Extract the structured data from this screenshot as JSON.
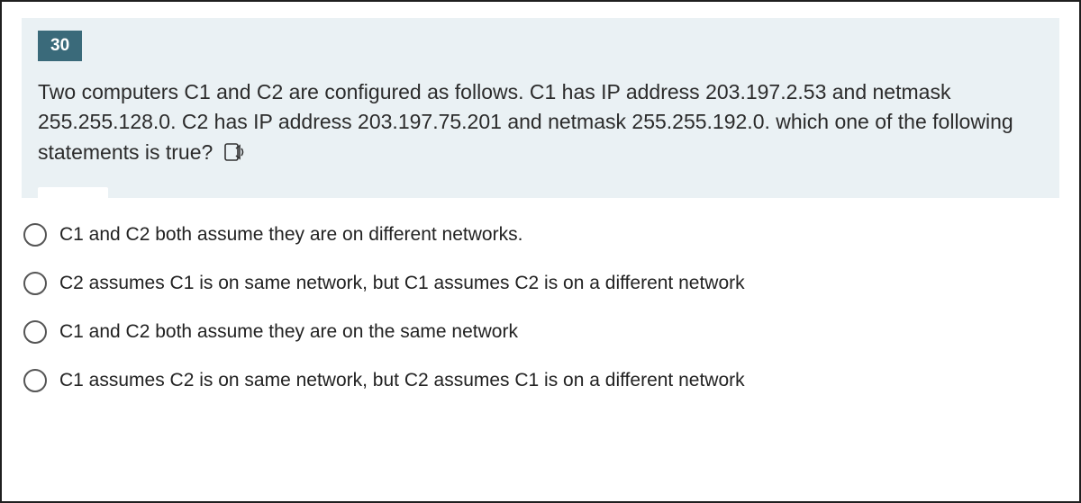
{
  "question": {
    "number": "30",
    "text": "Two computers C1 and C2 are configured as follows. C1 has IP address 203.197.2.53 and netmask 255.255.128.0. C2 has IP address 203.197.75.201 and netmask 255.255.192.0. which one of the following statements is true?"
  },
  "options": [
    {
      "label": "C1 and C2 both assume they are on different networks."
    },
    {
      "label": "C2 assumes C1 is on same network, but C1 assumes C2 is on a different network"
    },
    {
      "label": "C1 and C2 both assume they are on the same network"
    },
    {
      "label": "C1 assumes C2 is on same network, but C2 assumes C1 is on a different network"
    }
  ]
}
